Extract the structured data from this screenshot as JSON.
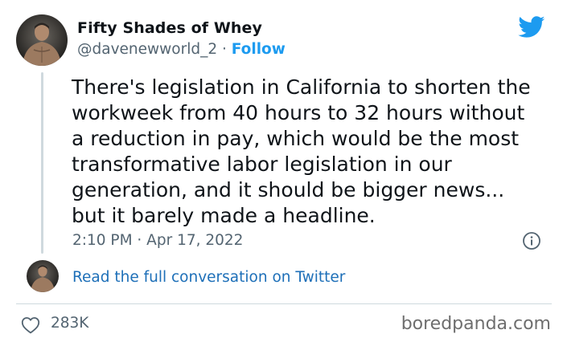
{
  "author": {
    "display_name": "Fifty Shades of Whey",
    "handle": "@davenewworld_2",
    "separator": "·",
    "follow_label": "Follow",
    "avatar_icon": "avatar-photo"
  },
  "tweet": {
    "text": "There's legislation in California to shorten the\nworkweek from 40 hours to 32 hours without\na reduction in pay, which would be the most\ntransformative labor legislation in our\ngeneration, and it should be bigger news...\nbut it barely made a headline.",
    "timestamp": "2:10 PM · Apr 17, 2022"
  },
  "thread": {
    "read_more_label": "Read the full conversation on Twitter"
  },
  "stats": {
    "likes": "283K",
    "like_icon": "heart-icon"
  },
  "watermark": "boredpanda.com",
  "colors": {
    "accent": "#1d9bf0",
    "text": "#0f1419",
    "muted": "#536471",
    "divider": "#cfd9de"
  }
}
